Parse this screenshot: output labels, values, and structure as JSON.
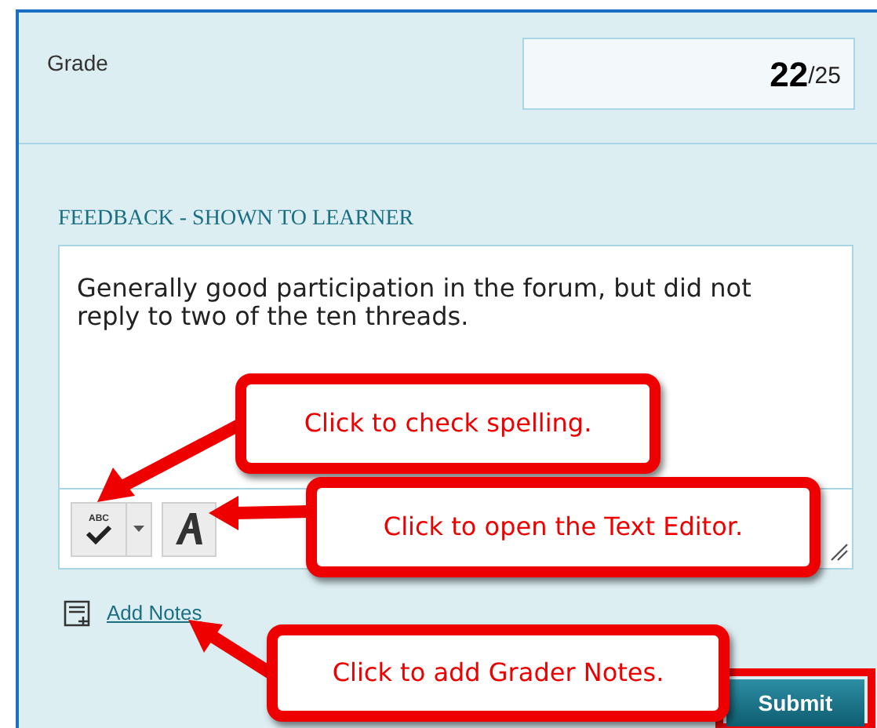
{
  "grade": {
    "label": "Grade",
    "score": "22",
    "out_of": "/25"
  },
  "feedback": {
    "heading": "FEEDBACK - SHOWN TO LEARNER",
    "value": "Generally good participation in the forum, but did not reply to two of the ten threads.",
    "spellcheck_label": "ABC"
  },
  "add_notes": {
    "label": "Add Notes"
  },
  "submit": {
    "label": "Submit"
  },
  "callouts": [
    {
      "text": "Click to check spelling."
    },
    {
      "text": "Click to open the Text Editor."
    },
    {
      "text": "Click to add Grader Notes."
    }
  ]
}
